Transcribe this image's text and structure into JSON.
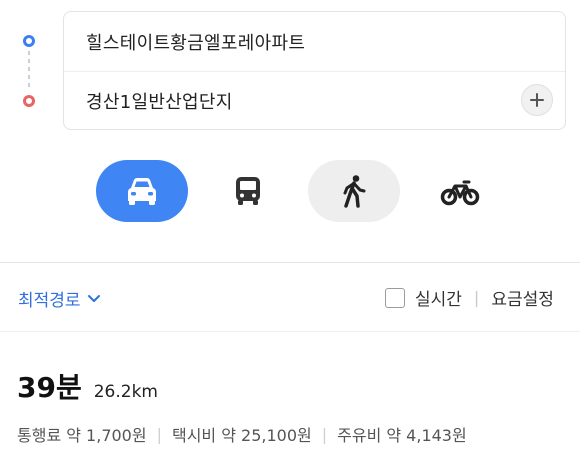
{
  "route": {
    "origin": "힐스테이트황금엘포레아파트",
    "destination": "경산1일반산업단지"
  },
  "modes": [
    {
      "name": "car",
      "icon": "car-icon",
      "selected": true
    },
    {
      "name": "bus",
      "icon": "bus-icon",
      "selected": false
    },
    {
      "name": "walk",
      "icon": "walking-icon",
      "selected": false
    },
    {
      "name": "bike",
      "icon": "bicycle-icon",
      "selected": false
    }
  ],
  "options": {
    "sort_label": "최적경로",
    "realtime_label": "실시간",
    "separator": "|",
    "fare_setting_label": "요금설정"
  },
  "summary": {
    "duration": "39분",
    "distance": "26.2km",
    "toll": "통행료 약 1,700원",
    "taxi": "택시비 약 25,100원",
    "fuel": "주유비 약 4,143원",
    "cost_separator": "|"
  },
  "colors": {
    "accent": "#3f85f4",
    "origin_dot": "#3d7ff2",
    "destination_dot": "#e86565"
  }
}
